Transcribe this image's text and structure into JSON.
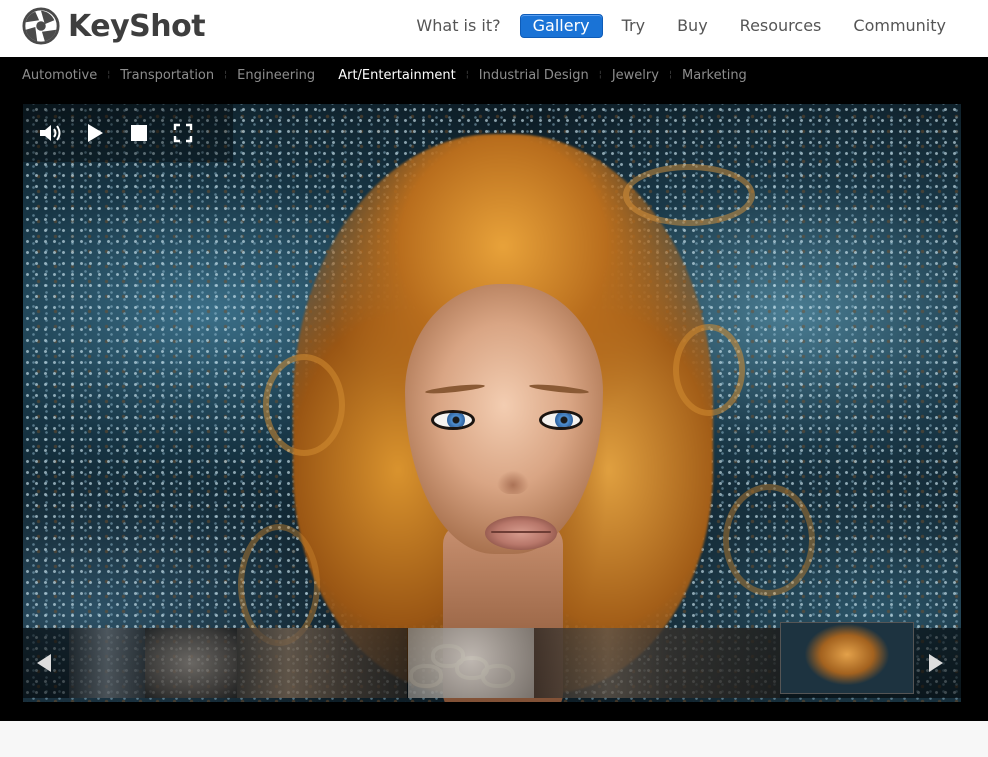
{
  "brand": {
    "name": "KeyShot",
    "icon": "keyshot-logo-icon"
  },
  "topnav": {
    "items": [
      {
        "label": "What is it?",
        "active": false
      },
      {
        "label": "Gallery",
        "active": true
      },
      {
        "label": "Try",
        "active": false
      },
      {
        "label": "Buy",
        "active": false
      },
      {
        "label": "Resources",
        "active": false
      },
      {
        "label": "Community",
        "active": false
      }
    ],
    "active_color": "#1a73d6"
  },
  "categories": {
    "items": [
      {
        "label": "Automotive",
        "active": false
      },
      {
        "label": "Transportation",
        "active": false
      },
      {
        "label": "Engineering",
        "active": false
      },
      {
        "label": "Art/Entertainment",
        "active": true
      },
      {
        "label": "Industrial Design",
        "active": false
      },
      {
        "label": "Jewelry",
        "active": false
      },
      {
        "label": "Marketing",
        "active": false
      }
    ]
  },
  "player": {
    "controls": [
      "volume-icon",
      "play-icon",
      "stop-icon",
      "fullscreen-icon"
    ],
    "thumbnails": [
      {
        "name": "thumb-1",
        "active": false
      },
      {
        "name": "thumb-2",
        "active": false
      },
      {
        "name": "thumb-3",
        "active": false
      },
      {
        "name": "thumb-4",
        "active": false
      },
      {
        "name": "thumb-5",
        "active": false
      },
      {
        "name": "thumb-6",
        "active": true
      }
    ],
    "prev_icon": "arrow-left-icon",
    "next_icon": "arrow-right-icon"
  }
}
